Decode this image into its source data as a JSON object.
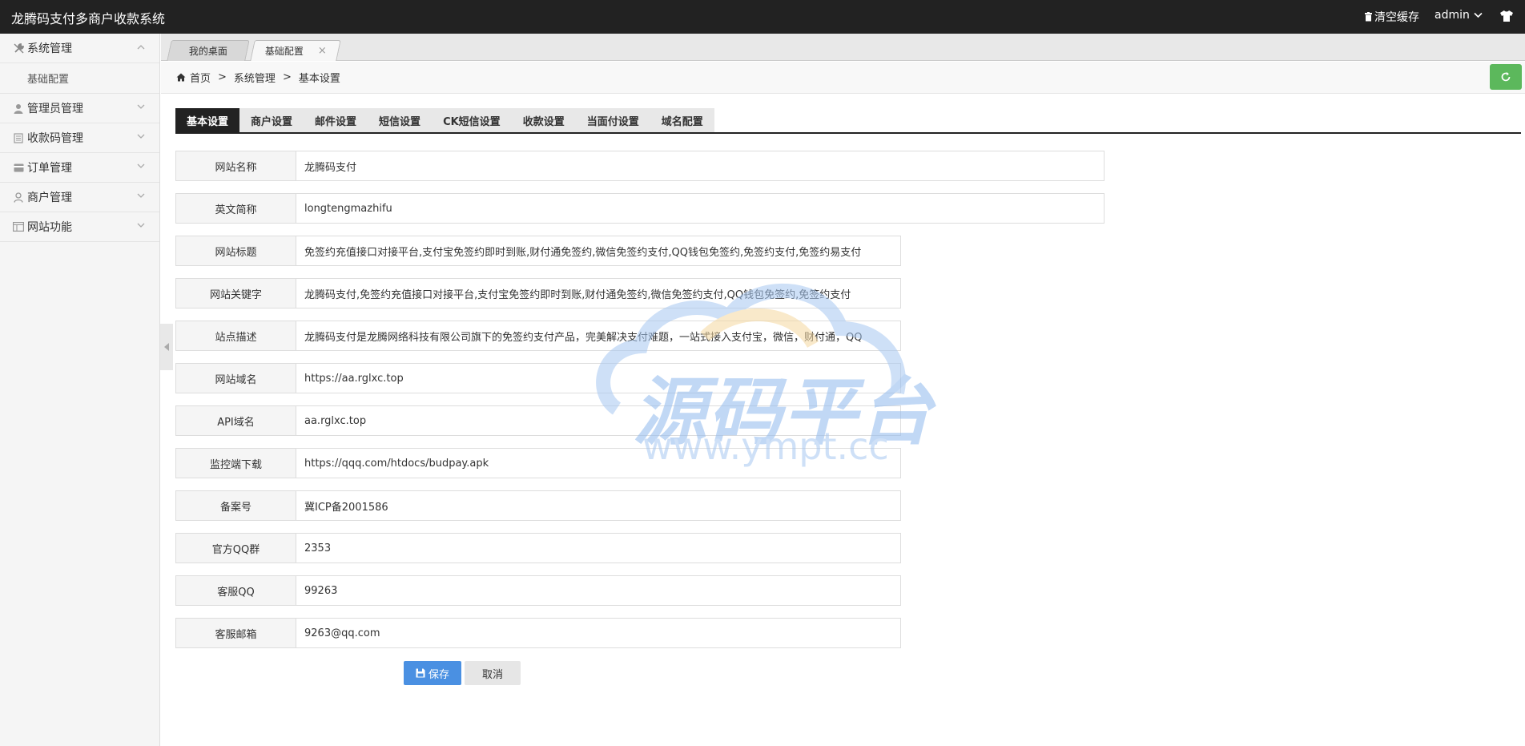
{
  "header": {
    "app_title": "龙腾码支付多商户收款系统",
    "clear_cache": "清空缓存",
    "user": "admin"
  },
  "sidebar": {
    "items": [
      {
        "label": "系统管理",
        "icon": "wrench-icon"
      },
      {
        "label": "基础配置"
      },
      {
        "label": "管理员管理",
        "icon": "user-icon"
      },
      {
        "label": "收款码管理",
        "icon": "document-icon"
      },
      {
        "label": "订单管理",
        "icon": "card-icon"
      },
      {
        "label": "商户管理",
        "icon": "merchant-icon"
      },
      {
        "label": "网站功能",
        "icon": "window-icon"
      }
    ]
  },
  "tabs": [
    {
      "label": "我的桌面"
    },
    {
      "label": "基础配置",
      "close": "×"
    }
  ],
  "breadcrumb": {
    "home": "首页",
    "sep": ">",
    "level1": "系统管理",
    "level2": "基本设置"
  },
  "settings_tabs": [
    "基本设置",
    "商户设置",
    "邮件设置",
    "短信设置",
    "CK短信设置",
    "收款设置",
    "当面付设置",
    "域名配置"
  ],
  "form": {
    "fields": [
      {
        "label": "网站名称",
        "value": "龙腾码支付"
      },
      {
        "label": "英文简称",
        "value": "longtengmazhifu"
      },
      {
        "label": "网站标题",
        "value": "免签约充值接口对接平台,支付宝免签约即时到账,财付通免签约,微信免签约支付,QQ钱包免签约,免签约支付,免签约易支付"
      },
      {
        "label": "网站关键字",
        "value": "龙腾码支付,免签约充值接口对接平台,支付宝免签约即时到账,财付通免签约,微信免签约支付,QQ钱包免签约,免签约支付"
      },
      {
        "label": "站点描述",
        "value": "龙腾码支付是龙腾网络科技有限公司旗下的免签约支付产品，完美解决支付难题，一站式接入支付宝，微信，财付通，QQ"
      },
      {
        "label": "网站域名",
        "value": "https://aa.rglxc.top"
      },
      {
        "label": "API域名",
        "value": "aa.rglxc.top"
      },
      {
        "label": "监控端下载",
        "value": "https://qqq.com/htdocs/budpay.apk"
      },
      {
        "label": "备案号",
        "value": "冀ICP备2001586"
      },
      {
        "label": "官方QQ群",
        "value": "2353"
      },
      {
        "label": "客服QQ",
        "value": "99263"
      },
      {
        "label": "客服邮箱",
        "value": "9263@qq.com"
      }
    ],
    "save_label": "保存",
    "cancel_label": "取消"
  },
  "watermark": {
    "title": "源码平台",
    "url": "www.ympt.cc"
  },
  "colors": {
    "topbar": "#222222",
    "accent_green": "#5cb85c",
    "save_blue": "#4a90e2"
  }
}
